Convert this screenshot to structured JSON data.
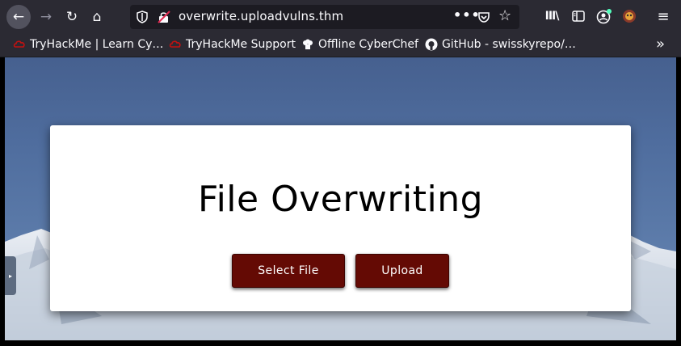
{
  "browser": {
    "url": "overwrite.uploadvulns.thm",
    "more_label": "•••",
    "star": "☆",
    "library_label": "III\\",
    "menu_label": "≡",
    "back": "←",
    "forward": "→",
    "reload": "↻",
    "home": "⌂",
    "overflow": "»"
  },
  "bookmarks": [
    {
      "label": "TryHackMe | Learn Cy…",
      "icon": "tryhackme-icon"
    },
    {
      "label": "TryHackMe Support",
      "icon": "tryhackme-icon"
    },
    {
      "label": "Offline CyberChef",
      "icon": "chef-icon"
    },
    {
      "label": "GitHub - swisskyrepo/…",
      "icon": "github-icon"
    }
  ],
  "page": {
    "title": "File Overwriting",
    "select_button": "Select File",
    "upload_button": "Upload",
    "side_tab": "▸"
  },
  "colors": {
    "chrome": "#2b2a33",
    "urlbar": "#1c1b22",
    "button": "#640a04",
    "sky": "#4f6d9e"
  }
}
